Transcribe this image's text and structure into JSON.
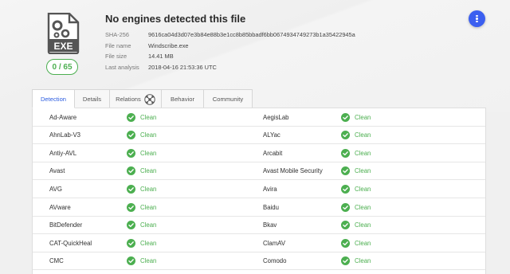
{
  "header": {
    "file_type": "EXE",
    "detection_ratio": "0 / 65",
    "title": "No engines detected this file",
    "meta": [
      {
        "key": "SHA-256",
        "value": "9616ca04d3d07e3b84e88b3e1cc8b85bbadf6bb0674934749273b1a35422945a"
      },
      {
        "key": "File name",
        "value": "Windscribe.exe"
      },
      {
        "key": "File size",
        "value": "14.41 MB"
      },
      {
        "key": "Last analysis",
        "value": "2018-04-16 21:53:36 UTC"
      }
    ]
  },
  "tabs": [
    {
      "label": "Detection"
    },
    {
      "label": "Details"
    },
    {
      "label": "Relations"
    },
    {
      "label": "Behavior"
    },
    {
      "label": "Community"
    }
  ],
  "results": [
    {
      "left": {
        "engine": "Ad-Aware",
        "status": "Clean"
      },
      "right": {
        "engine": "AegisLab",
        "status": "Clean"
      }
    },
    {
      "left": {
        "engine": "AhnLab-V3",
        "status": "Clean"
      },
      "right": {
        "engine": "ALYac",
        "status": "Clean"
      }
    },
    {
      "left": {
        "engine": "Antiy-AVL",
        "status": "Clean"
      },
      "right": {
        "engine": "Arcabit",
        "status": "Clean"
      }
    },
    {
      "left": {
        "engine": "Avast",
        "status": "Clean"
      },
      "right": {
        "engine": "Avast Mobile Security",
        "status": "Clean"
      }
    },
    {
      "left": {
        "engine": "AVG",
        "status": "Clean"
      },
      "right": {
        "engine": "Avira",
        "status": "Clean"
      }
    },
    {
      "left": {
        "engine": "AVware",
        "status": "Clean"
      },
      "right": {
        "engine": "Baidu",
        "status": "Clean"
      }
    },
    {
      "left": {
        "engine": "BitDefender",
        "status": "Clean"
      },
      "right": {
        "engine": "Bkav",
        "status": "Clean"
      }
    },
    {
      "left": {
        "engine": "CAT-QuickHeal",
        "status": "Clean"
      },
      "right": {
        "engine": "ClamAV",
        "status": "Clean"
      }
    },
    {
      "left": {
        "engine": "CMC",
        "status": "Clean"
      },
      "right": {
        "engine": "Comodo",
        "status": "Clean"
      }
    }
  ],
  "colors": {
    "clean": "#4caf50",
    "accent": "#3b5ff0",
    "tab_active": "#2b5ce0"
  },
  "icons": {
    "file": "exe-file-icon",
    "menu": "more-vert-icon",
    "relations": "graph-icon",
    "status": "check-circle-icon"
  }
}
